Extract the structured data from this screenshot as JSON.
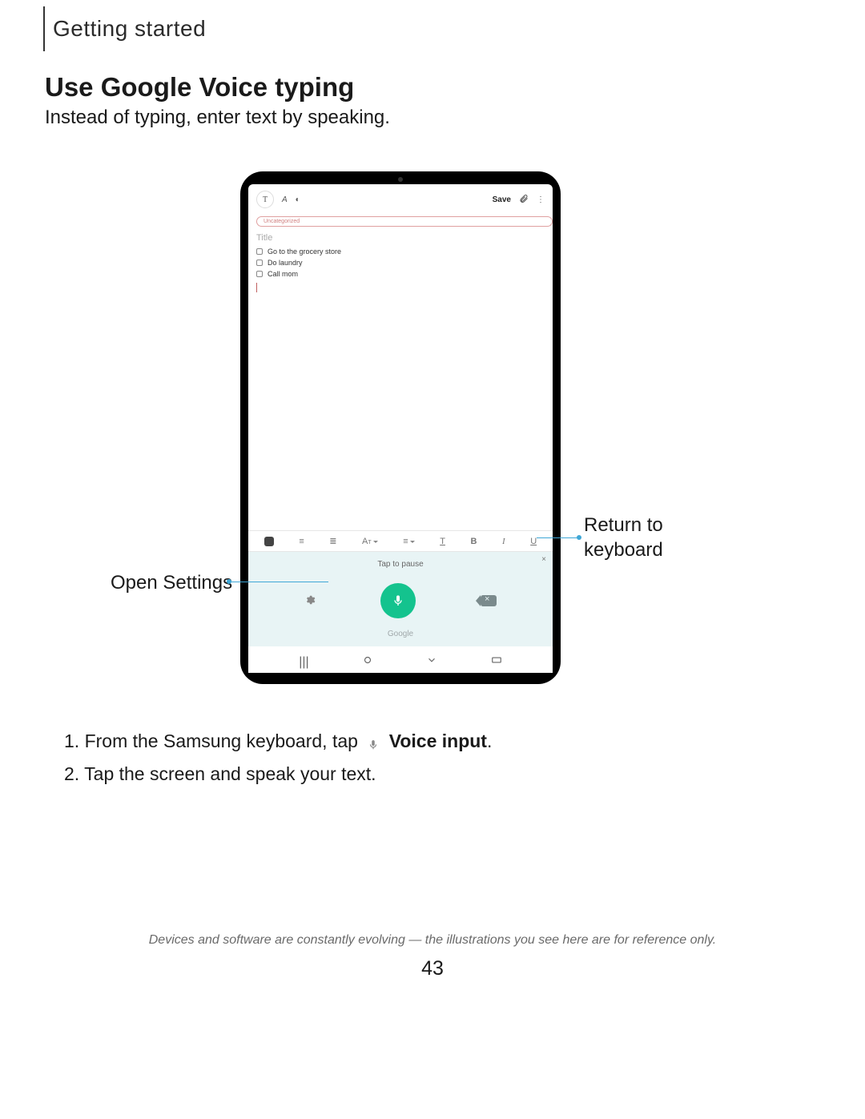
{
  "chapter": "Getting started",
  "heading": "Use Google Voice typing",
  "intro": "Instead of typing, enter text by speaking.",
  "device": {
    "toolbar": {
      "text_mode": "T",
      "pen_mode": "✎",
      "highlight_mode": "◑",
      "save": "Save",
      "attach": "📎",
      "more": "⋮"
    },
    "tag_label": "Uncategorized",
    "title_placeholder": "Title",
    "todos": [
      "Go to the grocery store",
      "Do laundry",
      "Call mom"
    ],
    "format": {
      "checkbox": "cb",
      "bullets": "≡",
      "numbered": "≣",
      "font": "Aᵀ",
      "align": "≡",
      "strike": "T",
      "bold": "B",
      "italic": "I",
      "underline": "U"
    },
    "voice": {
      "close": "×",
      "tap_to_pause": "Tap to pause",
      "settings": "⚙",
      "google": "Google"
    },
    "nav": {
      "recents": "|||",
      "home": "○",
      "back": "⌄",
      "kbd": "⌨"
    }
  },
  "callouts": {
    "return_to_keyboard": "Return to keyboard",
    "open_settings": "Open Settings"
  },
  "steps": {
    "one_prefix": "1.  From the Samsung keyboard, tap",
    "one_suffix_bold": "Voice input",
    "one_period": ".",
    "two": "2.  Tap the screen and speak your text."
  },
  "disclaimer": "Devices and software are constantly evolving — the illustrations you see here are for reference only.",
  "page_number": "43"
}
